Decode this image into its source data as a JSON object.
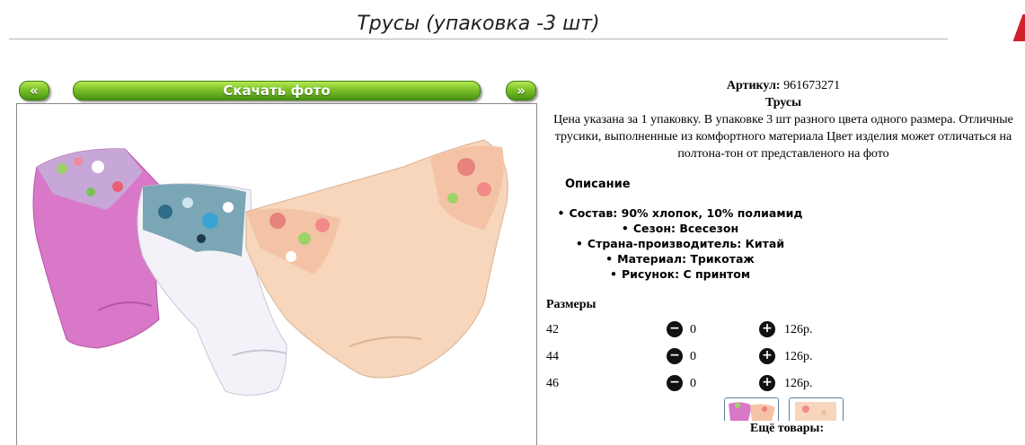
{
  "header": {
    "title": "Трусы (упаковка -3 шт)"
  },
  "nav": {
    "prev_label": "«",
    "download_label": "Скачать фото",
    "next_label": "»"
  },
  "product": {
    "article_label": "Артикул:",
    "article_value": "961673271",
    "name": "Трусы",
    "description": "Цена указана за 1 упаковку. В упаковке 3 шт разного цвета одного размера. Отличные трусики, выполненные из комфортного материала Цвет изделия может отличаться на полтона-тон от представленого на фото"
  },
  "specs": {
    "title": "Описание",
    "items": [
      "Состав: 90% хлопок, 10% полиамид",
      "Сезон: Всесезон",
      "Страна-производитель: Китай",
      "Материал: Трикотаж",
      "Рисунок: С принтом"
    ]
  },
  "sizes": {
    "title": "Размеры",
    "rows": [
      {
        "size": "42",
        "qty": "0",
        "price": "126р."
      },
      {
        "size": "44",
        "qty": "0",
        "price": "126р."
      },
      {
        "size": "46",
        "qty": "0",
        "price": "126р."
      }
    ]
  },
  "more": {
    "title": "Ещё товары:"
  },
  "colors": {
    "button_green": "#7cc02a",
    "panty_pink": "#d978c8",
    "panty_white": "#f4f2f8",
    "panty_peach": "#f7d6bb",
    "accent_red": "#d2202a"
  },
  "icons": {
    "minus": "minus-circle-icon",
    "plus": "plus-circle-icon"
  }
}
